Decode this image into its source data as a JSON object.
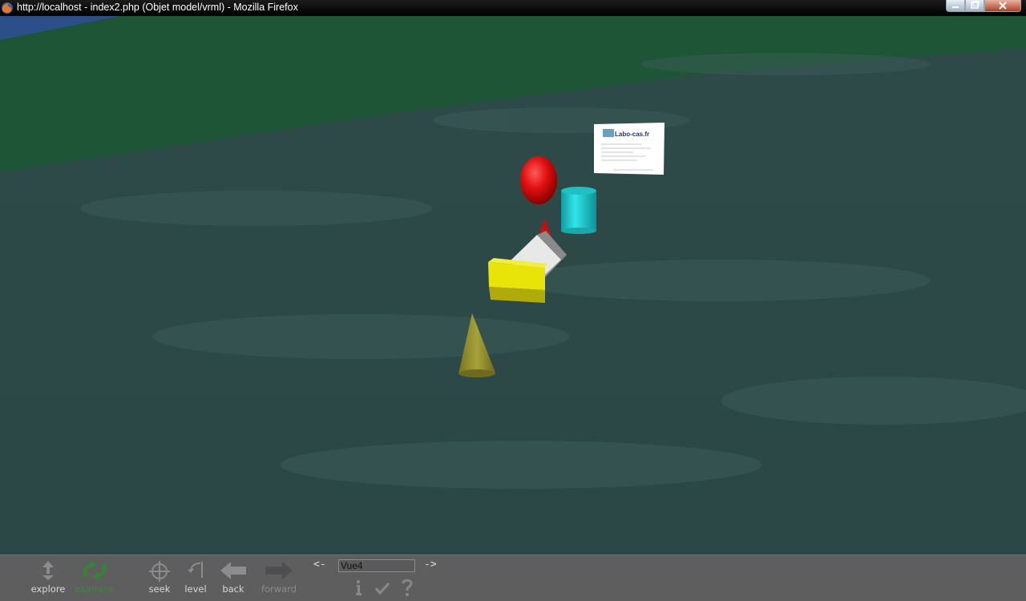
{
  "window": {
    "title": "http://localhost - index2.php (Objet model/vrml) - Mozilla Firefox",
    "buttons": [
      "minimize-icon",
      "maximize-icon",
      "close-icon"
    ]
  },
  "scene": {
    "billboard_text": "Labo-cas.fr",
    "colors": {
      "sky": "#2f4f7a",
      "ground_far": "#1f5a3c",
      "water": "#2f4c4a",
      "sphere": "#e01010",
      "cylinder": "#22d4d8",
      "box": "#e8e40a",
      "cone": "#9a9530",
      "slab": "#e6e6e6",
      "small_cone": "#c21010"
    }
  },
  "toolbar": {
    "explore": "explore",
    "examine": "examine",
    "seek": "seek",
    "level": "level",
    "back": "back",
    "forward": "forward",
    "prev_viewpoint": "<-",
    "next_viewpoint": "->",
    "viewpoint_value": "Vue4",
    "info_icon": "info-icon",
    "check_icon": "check-icon",
    "help_icon": "help-icon"
  }
}
